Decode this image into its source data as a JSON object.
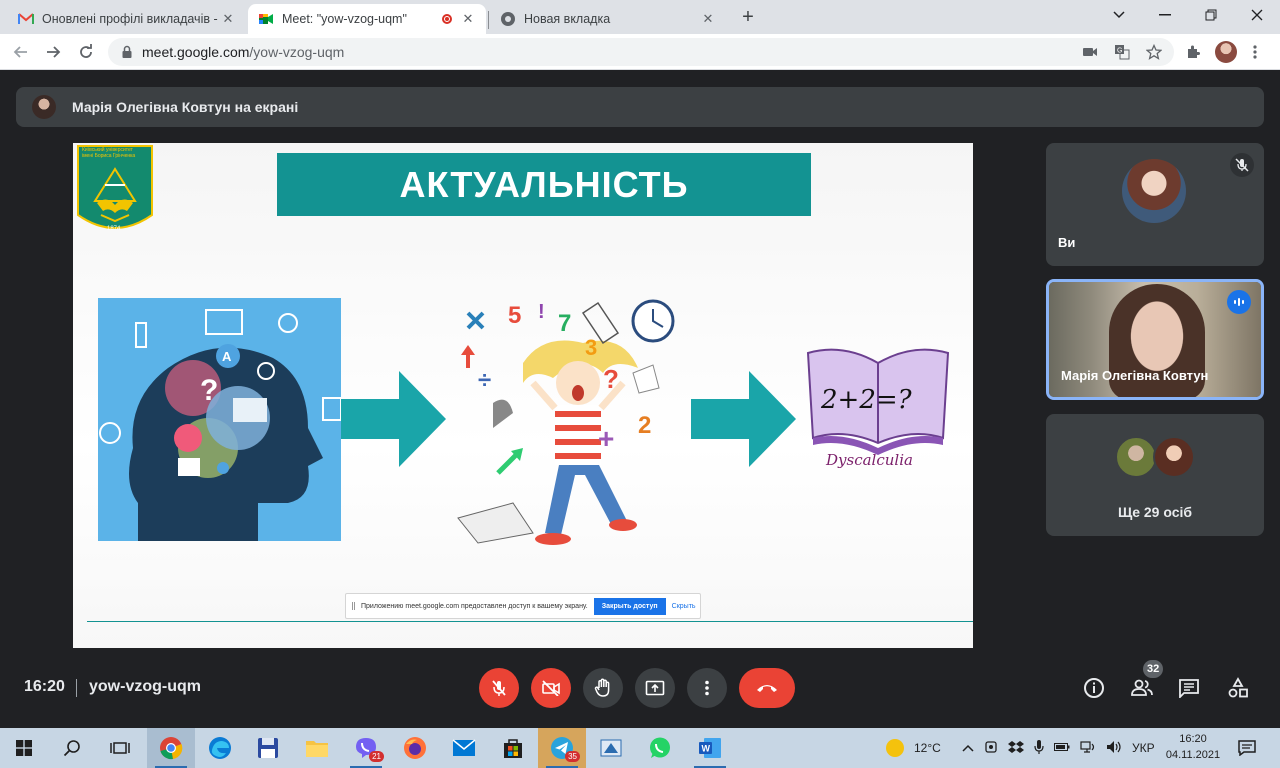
{
  "browser": {
    "tabs": [
      {
        "title": "Оновлені профілі викладачів - I",
        "icon": "gmail-icon"
      },
      {
        "title": "Meet: \"yow-vzog-uqm\"",
        "icon": "meet-icon",
        "recording": true
      },
      {
        "title": "Новая вкладка",
        "icon": "chrome-icon"
      }
    ],
    "url_host": "meet.google.com",
    "url_path": "/yow-vzog-uqm"
  },
  "meet": {
    "presenting_banner": "Марія Олегівна Ковтун на екрані",
    "slide": {
      "title": "АКТУАЛЬНІСТЬ",
      "logo_text_line1": "Київський університет",
      "logo_text_line2": "імені Бориса Грінченка",
      "logo_year": "1874",
      "book_equation": "2+2=?",
      "book_caption": "Dyscalculia",
      "kid_symbols": [
        "5",
        "!",
        "7",
        "3",
        "?",
        "2",
        "+",
        "÷"
      ],
      "share_bar": {
        "message": "Приложению meet.google.com предоставлен доступ к вашему экрану.",
        "stop_label": "Закрыть доступ",
        "hide_label": "Скрыть"
      }
    },
    "participants": [
      {
        "name": "Ви",
        "muted": true
      },
      {
        "name": "Марія Олегівна Ковтун",
        "speaking": true
      },
      {
        "name": "Ще 29 осіб"
      }
    ],
    "time": "16:20",
    "meeting_code": "yow-vzog-uqm",
    "people_count": "32"
  },
  "taskbar": {
    "viber_badge": "21",
    "telegram_badge": "35",
    "weather": "12°C",
    "lang": "УКР",
    "clock_time": "16:20",
    "clock_date": "04.11.2021"
  },
  "colors": {
    "meet_bg": "#202124",
    "tile_bg": "#3c4043",
    "red": "#ea4335",
    "blue": "#1a73e8",
    "slide_teal": "#139392"
  }
}
